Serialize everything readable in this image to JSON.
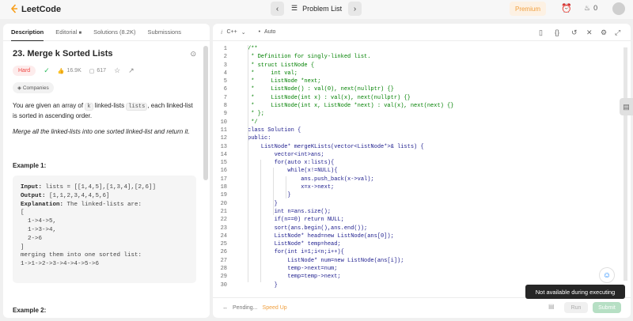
{
  "topbar": {
    "logo_text": "LeetCode",
    "problem_list": "Problem List",
    "premium": "Premium",
    "streak": "0"
  },
  "left_tabs": [
    "Description",
    "Editorial",
    "Solutions (8.2K)",
    "Submissions"
  ],
  "problem": {
    "title": "23. Merge k Sorted Lists",
    "difficulty": "Hard",
    "likes": "16.9K",
    "comments": "617",
    "companies": "Companies",
    "desc_pre": "You are given an array of ",
    "desc_k": "k",
    "desc_mid": " linked-lists ",
    "desc_code": "lists",
    "desc_post": ", each linked-list is sorted in ascending order.",
    "italic": "Merge all the linked-lists into one sorted linked-list and return it.",
    "example1_title": "Example 1:",
    "example1_input_label": "Input:",
    "example1_input": " lists = [[1,4,5],[1,3,4],[2,6]]",
    "example1_output_label": "Output:",
    "example1_output": " [1,1,2,3,4,4,5,6]",
    "example1_expl_label": "Explanation:",
    "example1_expl": " The linked-lists are:\n[\n  1->4->5,\n  1->3->4,\n  2->6\n]\nmerging them into one sorted list:\n1->1->2->3->4->4->5->6",
    "example2_title": "Example 2:"
  },
  "editor": {
    "language": "C++",
    "mode": "Auto"
  },
  "code_lines": [
    "/**",
    " * Definition for singly-linked list.",
    " * struct ListNode {",
    " *     int val;",
    " *     ListNode *next;",
    " *     ListNode() : val(0), next(nullptr) {}",
    " *     ListNode(int x) : val(x), next(nullptr) {}",
    " *     ListNode(int x, ListNode *next) : val(x), next(next) {}",
    " * };",
    " */",
    "class Solution {",
    "public:",
    "    ListNode* mergeKLists(vector<ListNode*>& lists) {",
    "        vector<int>ans;",
    "        for(auto x:lists){",
    "            while(x!=NULL){",
    "                ans.push_back(x->val);",
    "                x=x->next;",
    "            }",
    "        }",
    "        int n=ans.size();",
    "        if(n==0) return NULL;",
    "        sort(ans.begin(),ans.end());",
    "        ListNode* head=new ListNode(ans[0]);",
    "        ListNode* temp=head;",
    "        for(int i=1;i<n;i++){",
    "            ListNode* num=new ListNode(ans[i]);",
    "            temp->next=num;",
    "            temp=temp->next;",
    "        }"
  ],
  "bottom": {
    "pending": "Pending...",
    "speed_up": "Speed Up",
    "run": "Run",
    "submit": "Submit",
    "tooltip": "Not available during executing"
  }
}
